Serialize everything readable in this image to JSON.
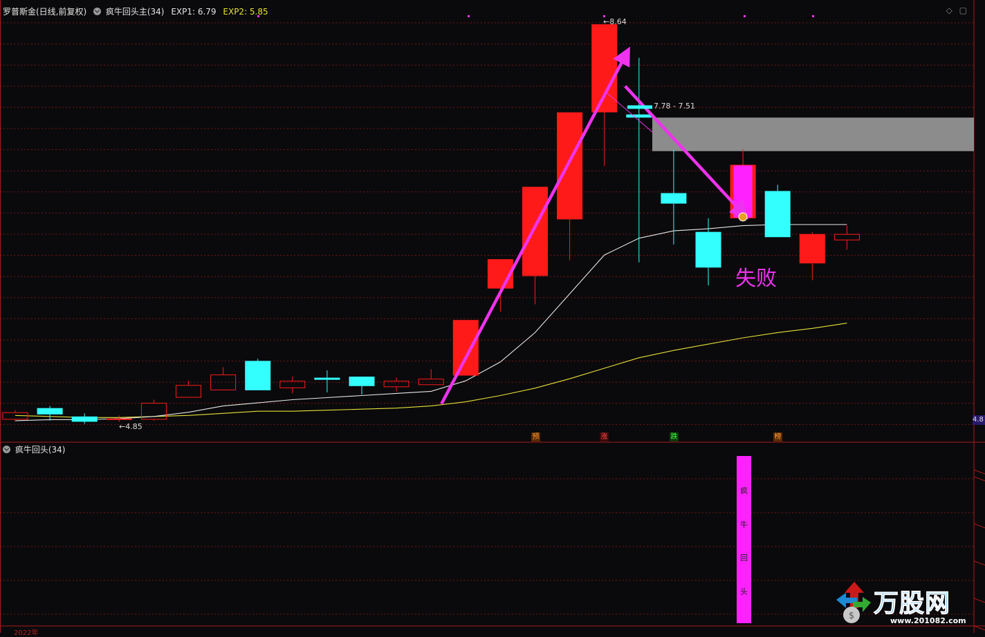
{
  "header": {
    "stock": "罗普斯金(日线,前复权)",
    "indicator": "疯牛回头主(34)",
    "exp1": "EXP1: 6.79",
    "exp2": "EXP2: 5.85"
  },
  "sub_header": {
    "indicator": "疯牛回头(34)"
  },
  "annotations": {
    "high_label": "8.64",
    "low_label": "4.85",
    "range_label": "7.78 - 7.51",
    "fail_text": "失败",
    "right_price": "4.8",
    "signal_1": "预",
    "signal_2": "涨",
    "signal_3": "跌",
    "signal_4": "榜",
    "vbar_chars": [
      "疯",
      "牛",
      "回",
      "头"
    ],
    "bottom_date": "2022年"
  },
  "watermark": {
    "name": "万股网",
    "url": "www.201082.com"
  },
  "colors": {
    "up": "#ff1a1a",
    "down": "#33ffff",
    "ma1": "#e8e8e8",
    "ma2": "#e8e23a",
    "arrow": "#ee33ee",
    "zone": "#8c8c8c",
    "vbar": "#ff22ff",
    "grid": "#7a1414"
  },
  "chart_data": {
    "type": "candlestick",
    "price_axis": {
      "min": 4.8,
      "max": 8.7
    },
    "candles": [
      {
        "open": 4.87,
        "close": 4.94,
        "high": 4.96,
        "low": 4.85
      },
      {
        "open": 4.98,
        "close": 4.92,
        "high": 5.0,
        "low": 4.86
      },
      {
        "open": 4.9,
        "close": 4.85,
        "high": 4.93,
        "low": 4.83
      },
      {
        "open": 4.87,
        "close": 4.88,
        "high": 4.91,
        "low": 4.85
      },
      {
        "open": 4.87,
        "close": 5.03,
        "high": 5.06,
        "low": 4.86
      },
      {
        "open": 5.08,
        "close": 5.2,
        "high": 5.24,
        "low": 5.08
      },
      {
        "open": 5.15,
        "close": 5.3,
        "high": 5.37,
        "low": 5.15
      },
      {
        "open": 5.43,
        "close": 5.15,
        "high": 5.45,
        "low": 5.15
      },
      {
        "open": 5.17,
        "close": 5.24,
        "high": 5.28,
        "low": 5.12
      },
      {
        "open": 5.27,
        "close": 5.25,
        "high": 5.34,
        "low": 5.13
      },
      {
        "open": 5.28,
        "close": 5.19,
        "high": 5.28,
        "low": 5.11
      },
      {
        "open": 5.18,
        "close": 5.24,
        "high": 5.27,
        "low": 5.14
      },
      {
        "open": 5.2,
        "close": 5.26,
        "high": 5.35,
        "low": 5.2
      },
      {
        "open": 5.29,
        "close": 5.82,
        "high": 5.82,
        "low": 5.29
      },
      {
        "open": 6.12,
        "close": 6.4,
        "high": 6.4,
        "low": 5.9
      },
      {
        "open": 6.24,
        "close": 7.09,
        "high": 7.09,
        "low": 5.97
      },
      {
        "open": 6.78,
        "close": 7.8,
        "high": 7.8,
        "low": 6.39
      },
      {
        "open": 7.8,
        "close": 8.64,
        "high": 8.64,
        "low": 7.29
      },
      {
        "open": 7.78,
        "close": 7.75,
        "high": 8.32,
        "low": 6.37
      },
      {
        "open": 7.03,
        "close": 6.93,
        "high": 7.44,
        "low": 6.54
      },
      {
        "open": 6.66,
        "close": 6.32,
        "high": 6.79,
        "low": 6.15
      },
      {
        "open": 6.79,
        "close": 7.3,
        "high": 7.45,
        "low": 6.79
      },
      {
        "open": 7.05,
        "close": 6.61,
        "high": 7.11,
        "low": 6.61
      },
      {
        "open": 6.36,
        "close": 6.64,
        "high": 6.66,
        "low": 6.2
      },
      {
        "open": 6.58,
        "close": 6.64,
        "high": 6.72,
        "low": 6.49
      }
    ],
    "ma_short": [
      4.86,
      4.87,
      4.87,
      4.88,
      4.9,
      4.94,
      5.0,
      5.03,
      5.06,
      5.08,
      5.1,
      5.12,
      5.14,
      5.24,
      5.42,
      5.7,
      6.07,
      6.44,
      6.6,
      6.67,
      6.69,
      6.72,
      6.73,
      6.73,
      6.73
    ],
    "ma_long": [
      4.91,
      4.9,
      4.89,
      4.89,
      4.9,
      4.91,
      4.93,
      4.95,
      4.95,
      4.96,
      4.97,
      4.98,
      5.0,
      5.04,
      5.1,
      5.17,
      5.26,
      5.36,
      5.46,
      5.53,
      5.59,
      5.65,
      5.7,
      5.74,
      5.79
    ],
    "zone": {
      "from": 7.75,
      "to": 7.43
    },
    "arrows": [
      {
        "from_bar": 12.3,
        "from_price": 5.02,
        "to_bar": 17.7,
        "to_price": 8.4
      },
      {
        "from_bar": 17.6,
        "from_price": 8.05,
        "to_bar": 21.1,
        "to_price": 6.8
      }
    ],
    "signal_bar": 21
  }
}
